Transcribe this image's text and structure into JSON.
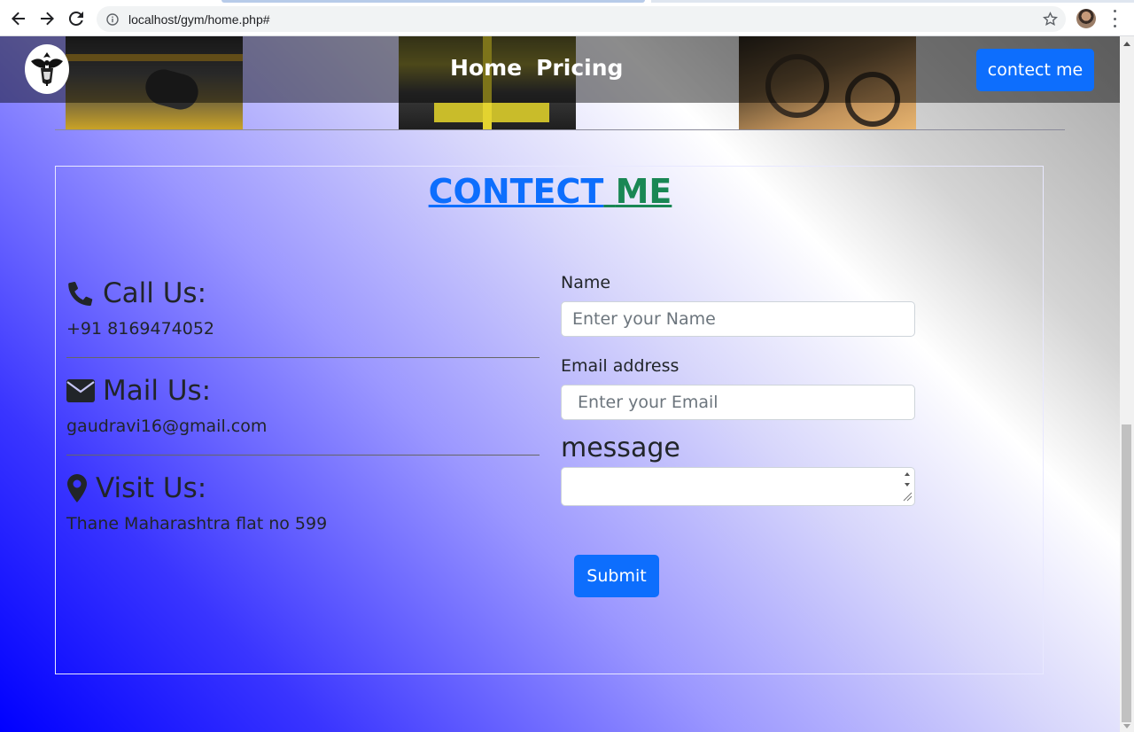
{
  "browser": {
    "url": "localhost/gym/home.php#",
    "back_icon": "back-arrow-icon",
    "forward_icon": "forward-arrow-icon",
    "reload_icon": "reload-icon",
    "info_icon": "info-icon",
    "bookmark_icon": "star-icon",
    "menu_icon": "kebab-menu-icon"
  },
  "navbar": {
    "links": [
      "Home",
      "Pricing"
    ],
    "contact_button": "contect me"
  },
  "contact": {
    "title_word1": "CONTECT",
    "title_word2": "ME",
    "call": {
      "heading": "Call Us:",
      "value": "+91 8169474052",
      "icon": "phone-icon"
    },
    "mail": {
      "heading": "Mail Us:",
      "value": "gaudravi16@gmail.com",
      "icon": "envelope-icon"
    },
    "visit": {
      "heading": "Visit Us:",
      "value": "Thane Maharashtra flat no 599",
      "icon": "map-marker-icon"
    }
  },
  "form": {
    "name_label": "Name",
    "name_placeholder": "Enter your Name",
    "email_label": "Email address",
    "email_placeholder": " Enter your Email",
    "message_label": "message",
    "submit_label": "Submit"
  },
  "colors": {
    "primary": "#0d6efd",
    "title_green": "#198754"
  }
}
